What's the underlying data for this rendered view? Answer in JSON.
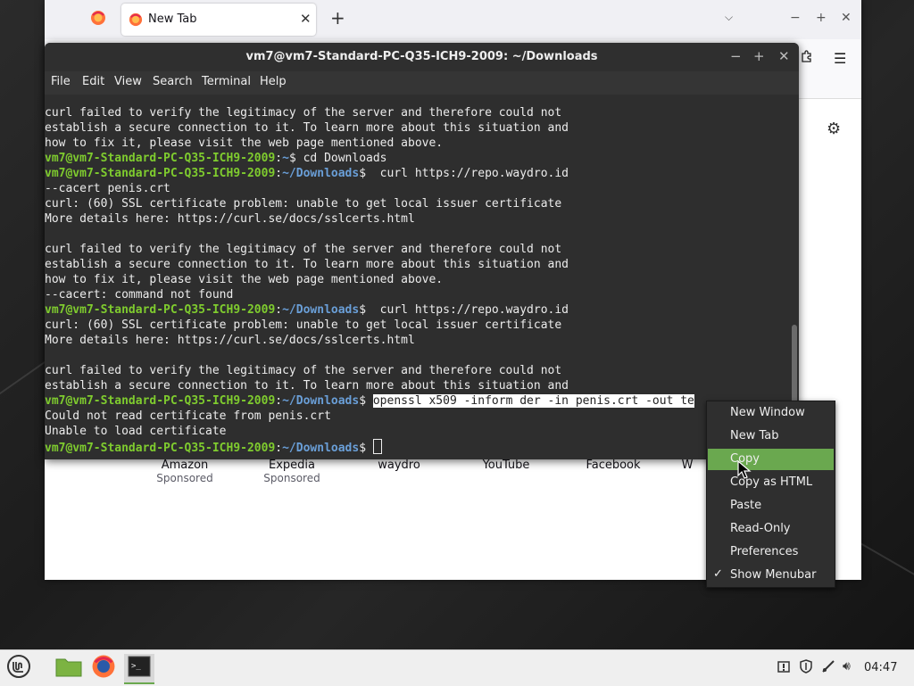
{
  "firefox": {
    "tab_title": "New Tab",
    "shortcuts": [
      {
        "name": "Amazon",
        "sub": "Sponsored"
      },
      {
        "name": "Expedia",
        "sub": "Sponsored"
      },
      {
        "name": "waydro",
        "sub": ""
      },
      {
        "name": "YouTube",
        "sub": ""
      },
      {
        "name": "Facebook",
        "sub": ""
      },
      {
        "name": "W",
        "sub": ""
      }
    ]
  },
  "terminal": {
    "title": "vm7@vm7-Standard-PC-Q35-ICH9-2009: ~/Downloads",
    "menu": [
      "File",
      "Edit",
      "View",
      "Search",
      "Terminal",
      "Help"
    ],
    "prompt_user": "vm7@vm7-Standard-PC-Q35-ICH9-2009",
    "prompt_home": "~",
    "prompt_dir": "~/Downloads",
    "lines": [
      {
        "type": "out",
        "text": "curl failed to verify the legitimacy of the server and therefore could not"
      },
      {
        "type": "out",
        "text": "establish a secure connection to it. To learn more about this situation and"
      },
      {
        "type": "out",
        "text": "how to fix it, please visit the web page mentioned above."
      },
      {
        "type": "prompt_home",
        "cmd": "$ cd Downloads"
      },
      {
        "type": "prompt",
        "cmd": "$  curl https://repo.waydro.id"
      },
      {
        "type": "out",
        "text": "--cacert penis.crt"
      },
      {
        "type": "out",
        "text": "curl: (60) SSL certificate problem: unable to get local issuer certificate"
      },
      {
        "type": "out",
        "text": "More details here: https://curl.se/docs/sslcerts.html"
      },
      {
        "type": "out",
        "text": ""
      },
      {
        "type": "out",
        "text": "curl failed to verify the legitimacy of the server and therefore could not"
      },
      {
        "type": "out",
        "text": "establish a secure connection to it. To learn more about this situation and"
      },
      {
        "type": "out",
        "text": "how to fix it, please visit the web page mentioned above."
      },
      {
        "type": "out",
        "text": "--cacert: command not found"
      },
      {
        "type": "prompt",
        "cmd": "$  curl https://repo.waydro.id"
      },
      {
        "type": "out",
        "text": "curl: (60) SSL certificate problem: unable to get local issuer certificate"
      },
      {
        "type": "out",
        "text": "More details here: https://curl.se/docs/sslcerts.html"
      },
      {
        "type": "out",
        "text": ""
      },
      {
        "type": "out",
        "text": "curl failed to verify the legitimacy of the server and therefore could not"
      },
      {
        "type": "out",
        "text": "establish a secure connection to it. To learn more about this situation and"
      },
      {
        "type": "prompt_sel",
        "cmd_pre": "$ ",
        "cmd_sel": "openssl x509 -inform der -in penis.crt -out te"
      },
      {
        "type": "out",
        "text": "Could not read certificate from penis.crt"
      },
      {
        "type": "out",
        "text": "Unable to load certificate"
      },
      {
        "type": "prompt_cursor",
        "cmd": "$ "
      }
    ]
  },
  "context_menu": {
    "items": [
      {
        "label": "New Window",
        "active": false,
        "checked": false
      },
      {
        "label": "New Tab",
        "active": false,
        "checked": false
      },
      {
        "label": "Copy",
        "active": true,
        "checked": false
      },
      {
        "label": "Copy as HTML",
        "active": false,
        "checked": false
      },
      {
        "label": "Paste",
        "active": false,
        "checked": false
      },
      {
        "label": "Read-Only",
        "active": false,
        "checked": false
      },
      {
        "label": "Preferences",
        "active": false,
        "checked": false
      },
      {
        "label": "Show Menubar",
        "active": false,
        "checked": true
      }
    ]
  },
  "taskbar": {
    "clock": "04:47"
  },
  "colors": {
    "prompt_user": "#7fcc2e",
    "prompt_path": "#6a9fd8",
    "menu_highlight": "#6aa84f"
  }
}
